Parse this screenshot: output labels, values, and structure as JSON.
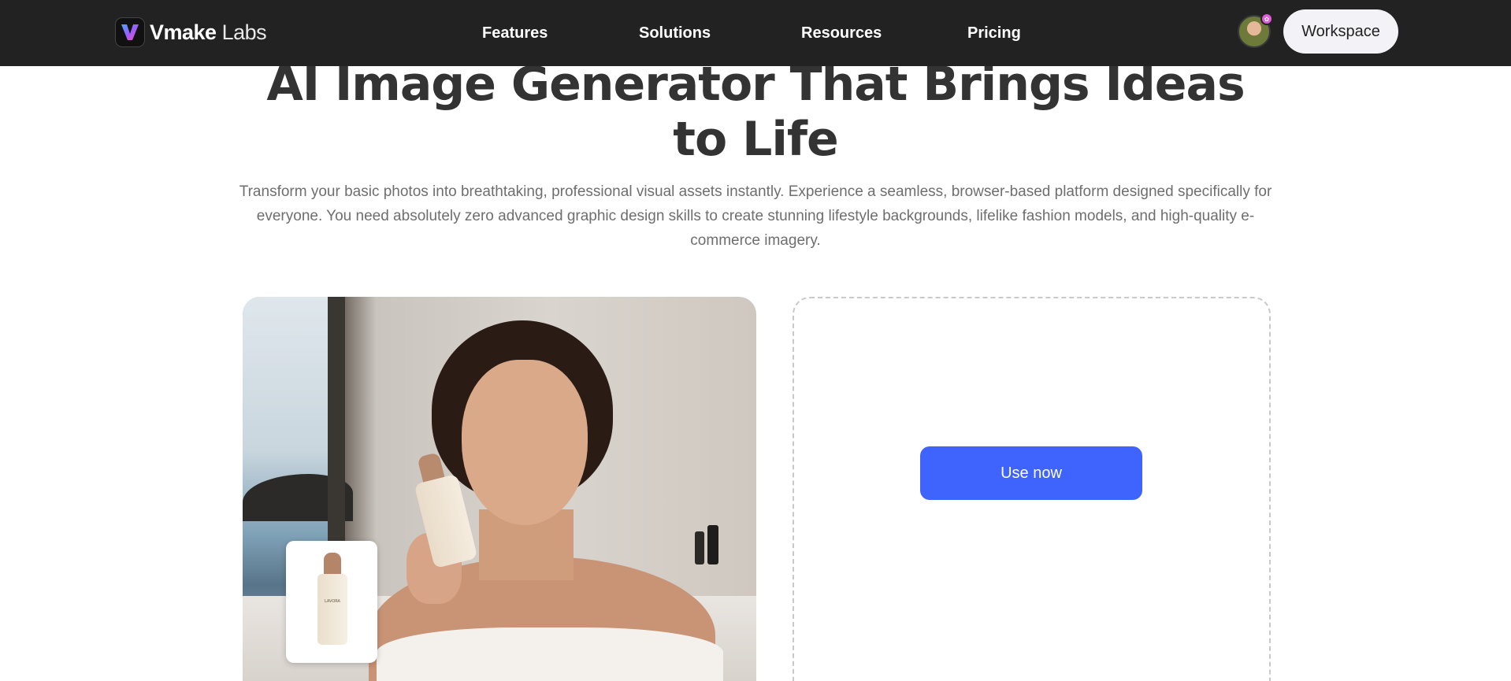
{
  "header": {
    "brand_bold": "Vmake",
    "brand_light": "Labs",
    "nav": [
      "Features",
      "Solutions",
      "Resources",
      "Pricing"
    ],
    "workspace_label": "Workspace"
  },
  "hero": {
    "title_line1": "AI Image Generator That Brings Ideas",
    "title_line2": "to Life",
    "subtitle": "Transform your basic photos into breathtaking, professional visual assets instantly. Experience a seamless, browser-based platform designed specifically for everyone. You need absolutely zero advanced graphic design skills to create stunning lifestyle backgrounds, lifelike fashion models, and high-quality e-commerce imagery."
  },
  "demo": {
    "thumbnail_product_label": "LAVORA",
    "use_button_label": "Use now"
  },
  "colors": {
    "nav_bg": "#222222",
    "accent": "#3f63fd",
    "title": "#333333",
    "subtitle": "#6e6e6e"
  },
  "icons": {
    "logo": "vmake-logo-icon",
    "avatar_badge": "gift-icon"
  }
}
